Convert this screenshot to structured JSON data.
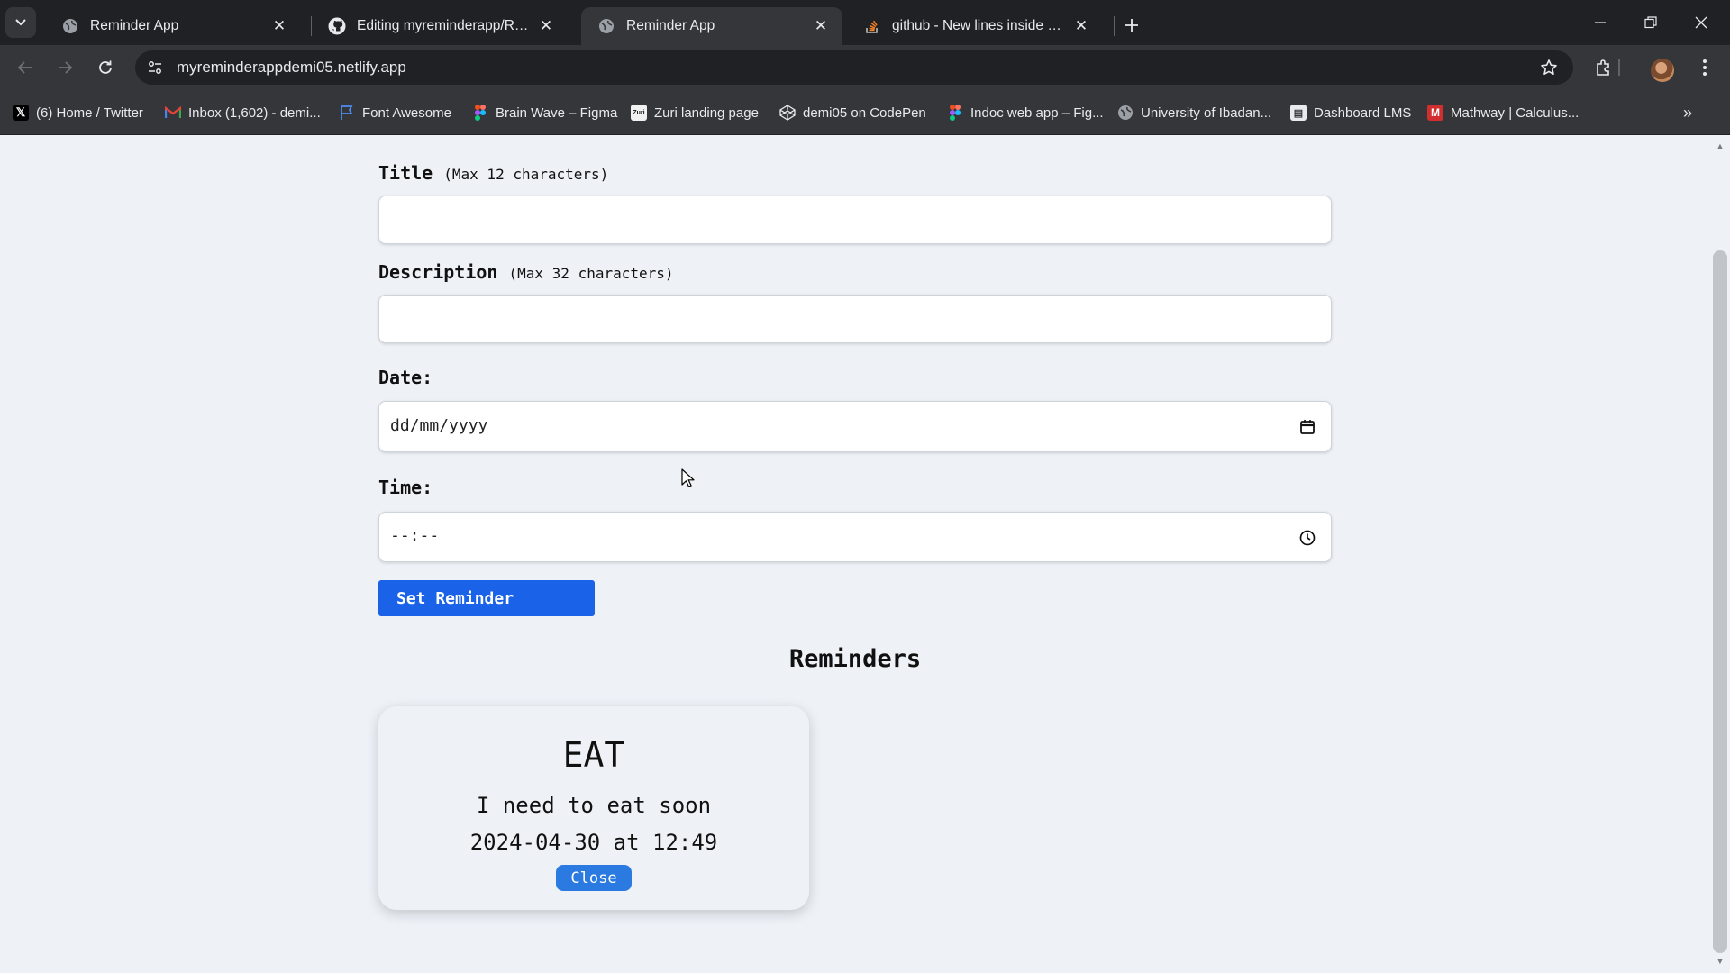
{
  "browser": {
    "tabs": [
      {
        "title": "Reminder App",
        "favicon": "globe-icon",
        "active": false
      },
      {
        "title": "Editing myreminderapp/READM",
        "favicon": "github-icon",
        "active": false
      },
      {
        "title": "Reminder App",
        "favicon": "globe-icon",
        "active": true
      },
      {
        "title": "github - New lines inside parag",
        "favicon": "stackoverflow-icon",
        "active": false
      }
    ],
    "url": "myreminderappdemi05.netlify.app",
    "bookmarks": [
      {
        "label": "(6) Home / Twitter",
        "icon": "x-twitter-icon"
      },
      {
        "label": "Inbox (1,602) - demi...",
        "icon": "gmail-icon"
      },
      {
        "label": "Font Awesome",
        "icon": "flag-icon"
      },
      {
        "label": "Brain Wave – Figma",
        "icon": "figma-icon"
      },
      {
        "label": "Zuri landing page",
        "icon": "zuri-icon"
      },
      {
        "label": "demi05 on CodePen",
        "icon": "codepen-icon"
      },
      {
        "label": "Indoc web app – Fig...",
        "icon": "figma-icon"
      },
      {
        "label": "University of Ibadan...",
        "icon": "globe-icon"
      },
      {
        "label": "Dashboard LMS",
        "icon": "lms-icon"
      },
      {
        "label": "Mathway | Calculus...",
        "icon": "mathway-icon"
      }
    ]
  },
  "form": {
    "title_label": "Title",
    "title_hint": "(Max 12 characters)",
    "title_value": "",
    "description_label": "Description",
    "description_hint": "(Max 32 characters)",
    "description_value": "",
    "date_label": "Date:",
    "date_placeholder": "dd/mm/yyyy",
    "time_label": "Time:",
    "time_placeholder": "--:--",
    "submit_label": "Set Reminder"
  },
  "reminders": {
    "heading": "Reminders",
    "items": [
      {
        "title": "EAT",
        "description": "I need to eat soon",
        "when": "2024-04-30 at 12:49",
        "close_label": "Close"
      }
    ]
  },
  "colors": {
    "page_background": "#eef2f7",
    "primary_button": "#1a62e8",
    "close_button": "#2a7ae2",
    "chrome_dark": "#202124",
    "chrome_toolbar": "#35363a"
  }
}
